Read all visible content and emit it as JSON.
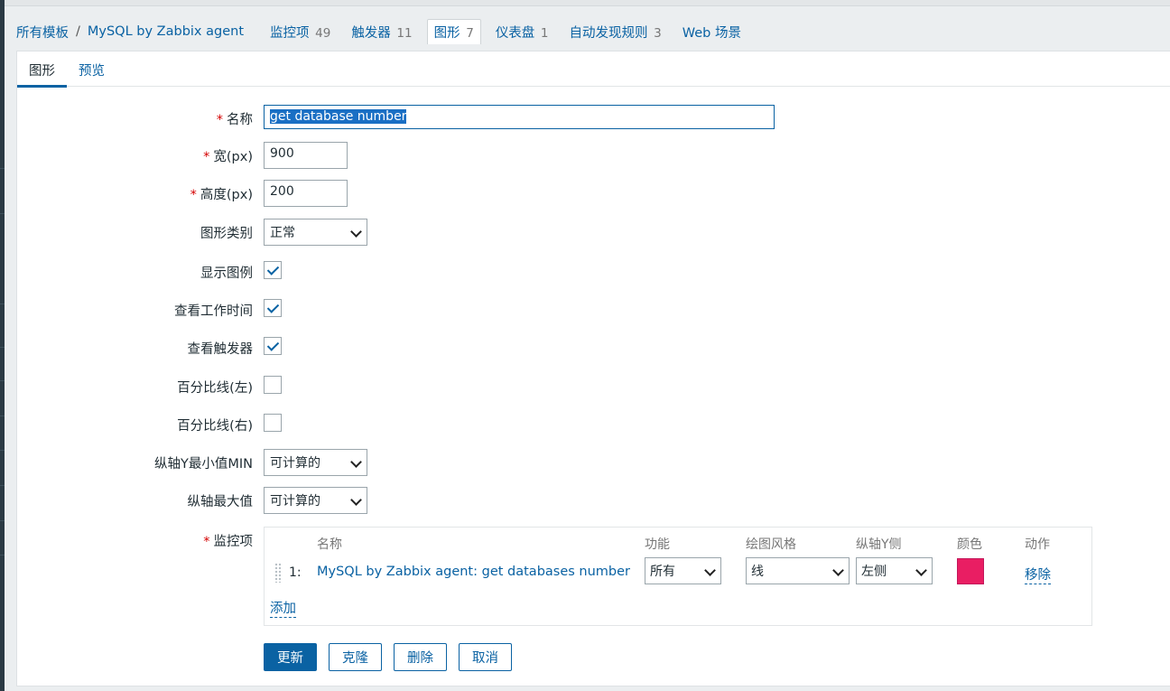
{
  "breadcrumb": {
    "all_templates": "所有模板",
    "separator": "/",
    "template_name": "MySQL by Zabbix agent",
    "tabs": [
      {
        "label": "监控项",
        "count": "49"
      },
      {
        "label": "触发器",
        "count": "11"
      },
      {
        "label": "图形",
        "count": "7"
      },
      {
        "label": "仪表盘",
        "count": "1"
      },
      {
        "label": "自动发现规则",
        "count": "3"
      },
      {
        "label": "Web 场景",
        "count": ""
      }
    ]
  },
  "subtabs": {
    "graph": "图形",
    "preview": "预览"
  },
  "form": {
    "name": {
      "label": "名称",
      "value": "get database number"
    },
    "width": {
      "label": "宽(px)",
      "value": "900"
    },
    "height": {
      "label": "高度(px)",
      "value": "200"
    },
    "graph_type": {
      "label": "图形类别",
      "value": "正常"
    },
    "show_legend": {
      "label": "显示图例",
      "checked": true
    },
    "show_working_time": {
      "label": "查看工作时间",
      "checked": true
    },
    "show_triggers": {
      "label": "查看触发器",
      "checked": true
    },
    "percentile_left": {
      "label": "百分比线(左)",
      "checked": false
    },
    "percentile_right": {
      "label": "百分比线(右)",
      "checked": false
    },
    "ymin": {
      "label": "纵轴Y最小值MIN",
      "value": "可计算的"
    },
    "ymax": {
      "label": "纵轴最大值",
      "value": "可计算的"
    },
    "items": {
      "label": "监控项",
      "headers": {
        "name": "名称",
        "function": "功能",
        "style": "绘图风格",
        "yaxis": "纵轴Y侧",
        "color": "颜色",
        "action": "动作"
      },
      "rows": [
        {
          "num": "1:",
          "name": "MySQL by Zabbix agent: get databases number",
          "function": "所有",
          "style": "线",
          "yaxis": "左侧",
          "color": "#e91e63",
          "action": "移除"
        }
      ],
      "add": "添加"
    }
  },
  "buttons": {
    "update": "更新",
    "clone": "克隆",
    "delete": "删除",
    "cancel": "取消"
  }
}
